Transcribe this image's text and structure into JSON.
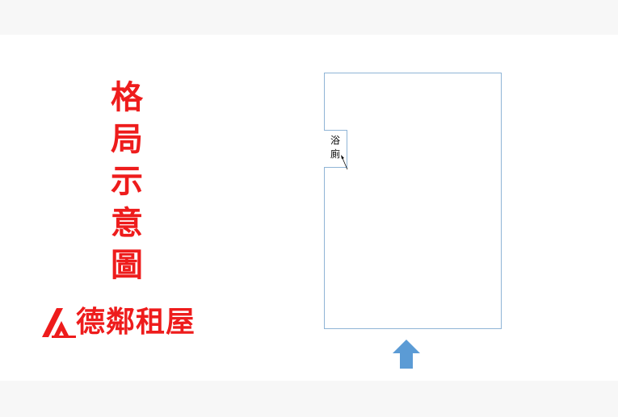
{
  "title": {
    "chars": [
      "格",
      "局",
      "示",
      "意",
      "圖"
    ]
  },
  "logo": {
    "text": "德鄰租屋",
    "brand_color": "#ee1c1c"
  },
  "floorplan": {
    "bathroom_label": [
      "浴",
      "廁"
    ],
    "wall_color": "#8fb4d6",
    "entrance_arrow_color": "#5b9bd5"
  }
}
